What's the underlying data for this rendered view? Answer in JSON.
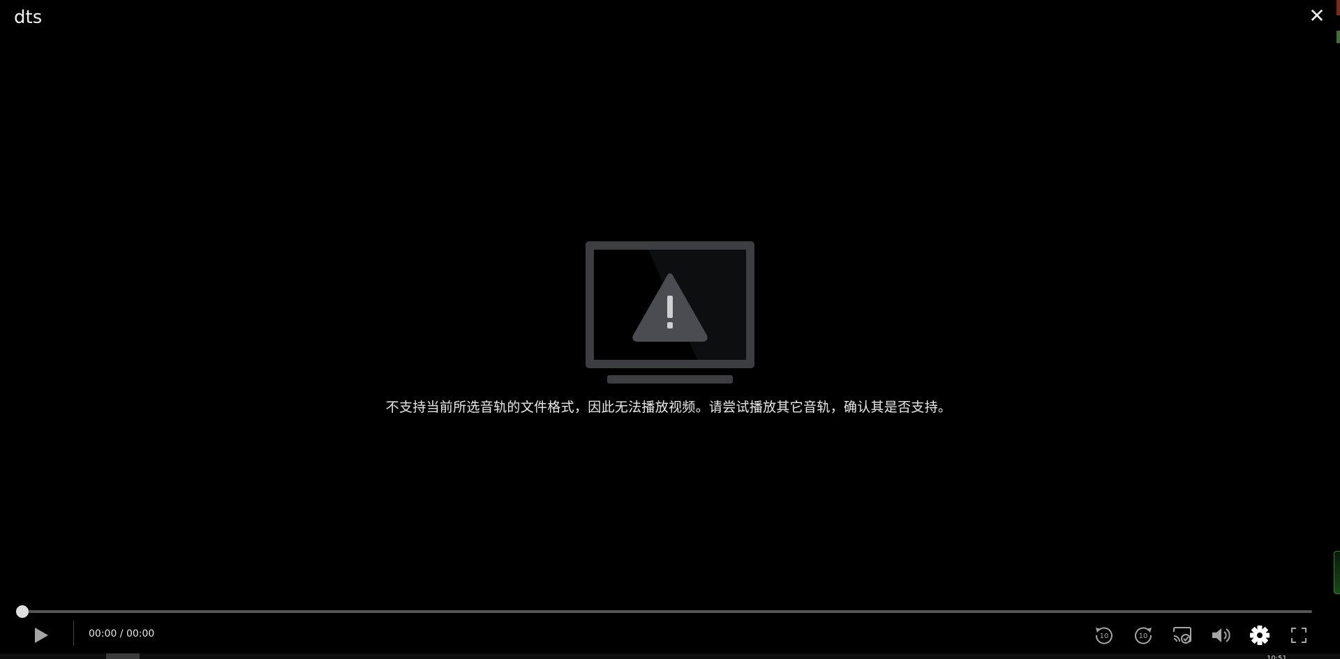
{
  "window": {
    "title": "dts",
    "close_label": "✕"
  },
  "error": {
    "icon": "tv-warning-icon",
    "message": "不支持当前所选音轨的文件格式，因此无法播放视频。请尝试播放其它音轨，确认其是否支持。"
  },
  "playback": {
    "progress_fraction": 0,
    "current_time": "00:00",
    "separator": " / ",
    "duration": "00:00"
  },
  "controls": {
    "play": "play-icon",
    "rewind": "rewind-10-icon",
    "rewind_label": "10",
    "forward": "forward-10-icon",
    "forward_label": "10",
    "cast": "cast-icon",
    "volume": "volume-icon",
    "settings": "gear-icon",
    "fullscreen": "fullscreen-icon"
  },
  "taskbar": {
    "clock": "10:51"
  },
  "colors": {
    "background": "#000000",
    "icon": "#a6a6a6",
    "icon_active": "#ffffff",
    "text": "#e9e9e9",
    "monitor_frame": "#3c3e42"
  }
}
